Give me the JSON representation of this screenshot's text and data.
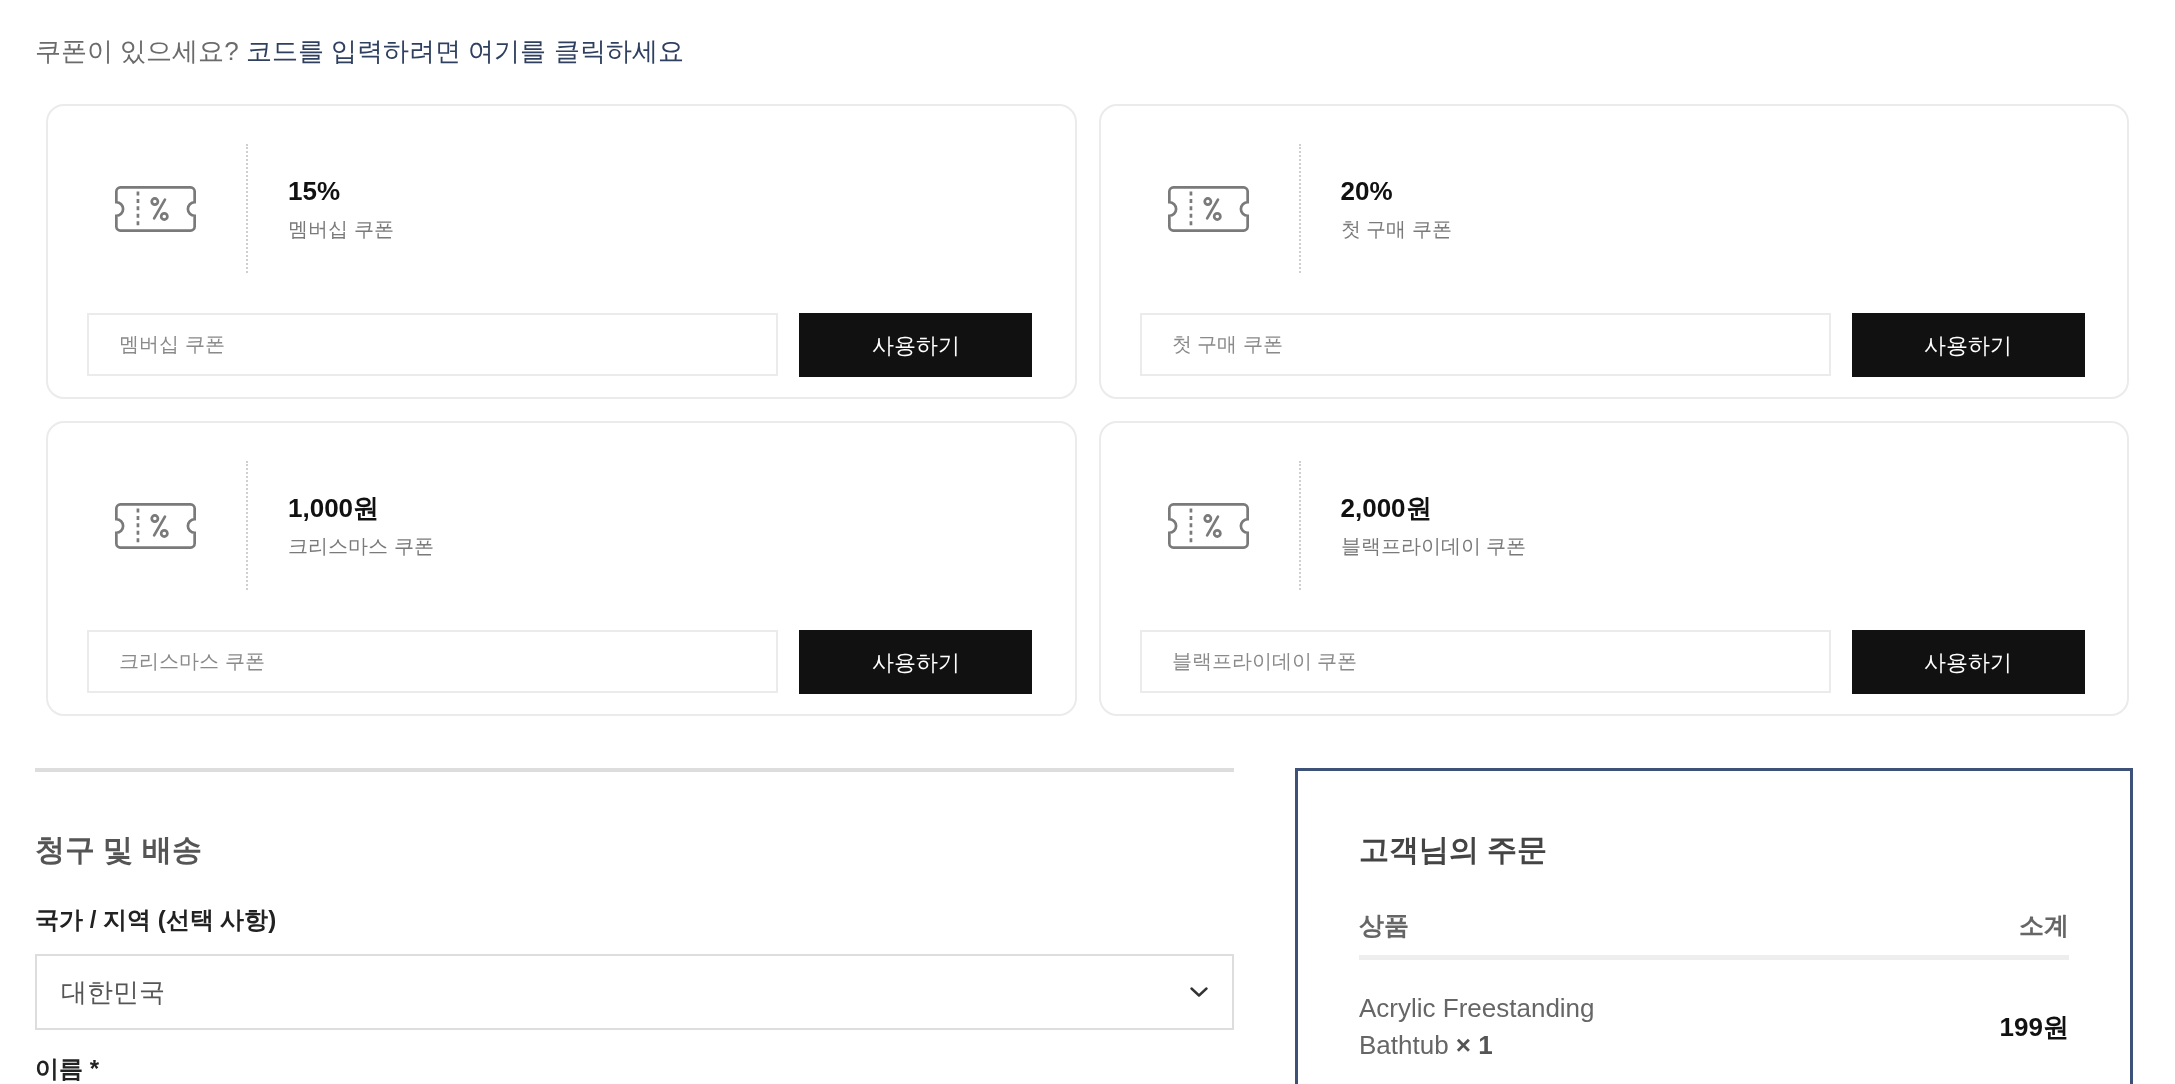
{
  "coupon_notice": {
    "text": "쿠폰이 있으세요?",
    "link": "코드를 입력하려면 여기를 클릭하세요"
  },
  "coupons": [
    {
      "amount": "15%",
      "name": "멤버십 쿠폰",
      "placeholder": "멤버십 쿠폰",
      "button": "사용하기"
    },
    {
      "amount": "20%",
      "name": "첫 구매 쿠폰",
      "placeholder": "첫 구매 쿠폰",
      "button": "사용하기"
    },
    {
      "amount": "1,000원",
      "name": "크리스마스 쿠폰",
      "placeholder": "크리스마스 쿠폰",
      "button": "사용하기"
    },
    {
      "amount": "2,000원",
      "name": "블랙프라이데이 쿠폰",
      "placeholder": "블랙프라이데이 쿠폰",
      "button": "사용하기"
    }
  ],
  "billing": {
    "title": "청구 및 배송",
    "fields": [
      {
        "kind": "select",
        "label": "국가 / 지역 (선택 사항)",
        "value": "대한민국"
      },
      {
        "kind": "text",
        "label": "이름 *"
      }
    ]
  },
  "order": {
    "title": "고객님의 주문",
    "columns": [
      "상품",
      "소계"
    ],
    "items": [
      {
        "product": "Acrylic Freestanding Bathtub **× 1**",
        "subtotal": "199원"
      }
    ]
  }
}
